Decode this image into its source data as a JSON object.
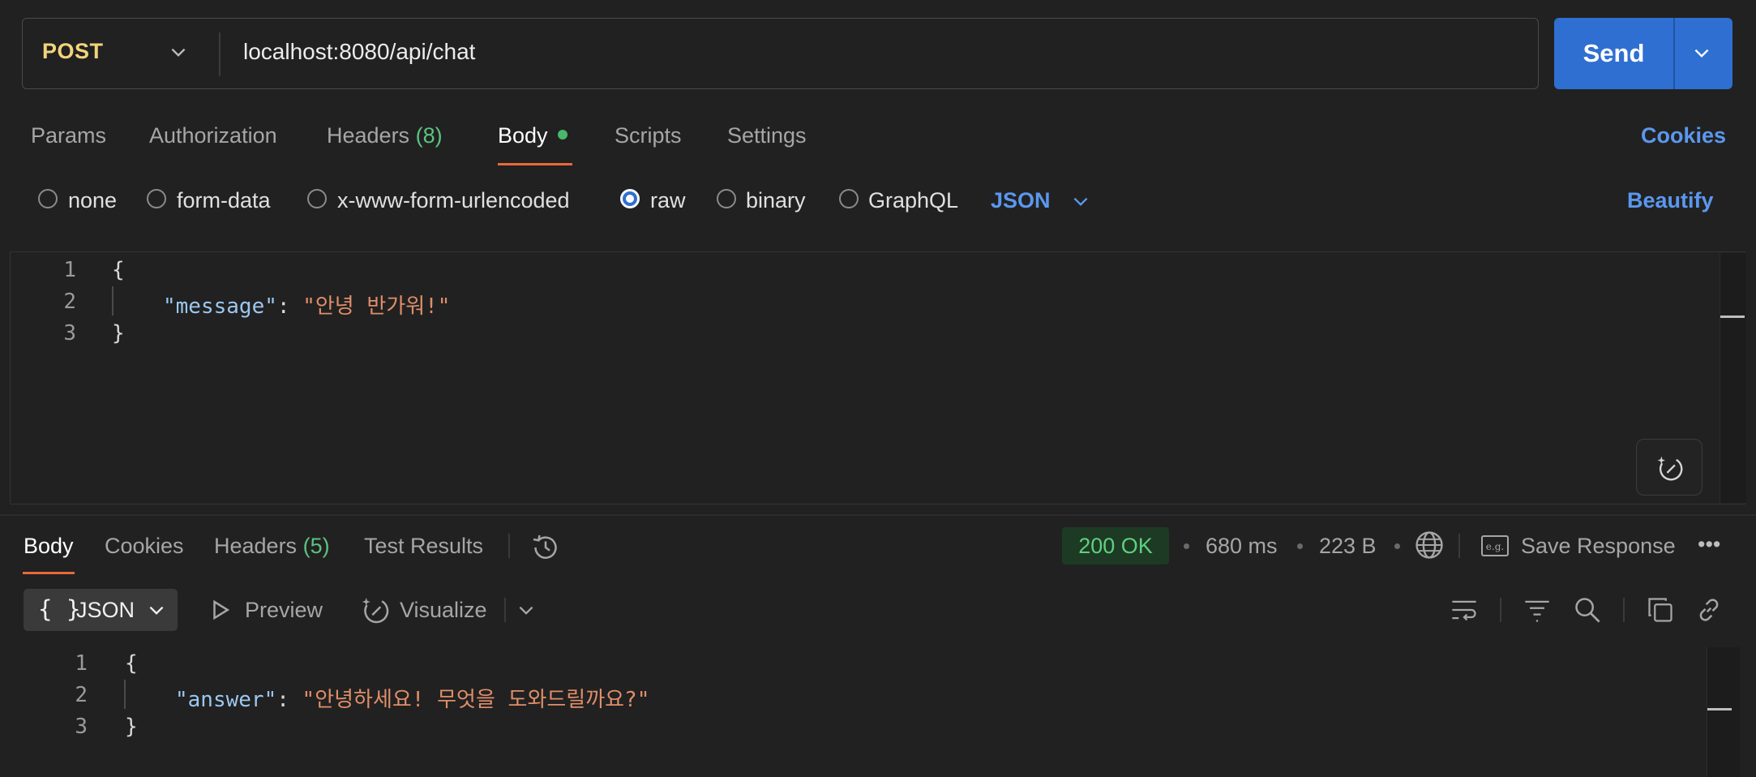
{
  "request": {
    "method": "POST",
    "url": "localhost:8080/api/chat",
    "send_label": "Send"
  },
  "request_tabs": [
    {
      "label": "Params"
    },
    {
      "label": "Authorization"
    },
    {
      "label": "Headers",
      "count": "(8)"
    },
    {
      "label": "Body"
    },
    {
      "label": "Scripts"
    },
    {
      "label": "Settings"
    }
  ],
  "cookies_link": "Cookies",
  "body_types": [
    "none",
    "form-data",
    "x-www-form-urlencoded",
    "raw",
    "binary",
    "GraphQL"
  ],
  "body_selected": "raw",
  "body_language": "JSON",
  "beautify_label": "Beautify",
  "request_body": {
    "line_numbers": [
      "1",
      "2",
      "3"
    ],
    "open_brace": "{",
    "key": "\"message\"",
    "colon": ": ",
    "value": "\"안녕 반가워!\"",
    "close_brace": "}"
  },
  "response_tabs": [
    {
      "label": "Body"
    },
    {
      "label": "Cookies"
    },
    {
      "label": "Headers",
      "count": "(5)"
    },
    {
      "label": "Test Results"
    }
  ],
  "response_meta": {
    "status": "200 OK",
    "time": "680 ms",
    "size": "223 B",
    "save_label": "Save Response",
    "more": "•••"
  },
  "response_toolbar": {
    "format_braces": "{ }",
    "format": "JSON",
    "preview": "Preview",
    "visualize": "Visualize"
  },
  "response_body": {
    "line_numbers": [
      "1",
      "2",
      "3"
    ],
    "open_brace": "{",
    "key": "\"answer\"",
    "colon": ": ",
    "value": "\"안녕하세요! 무엇을 도와드릴까요?\"",
    "close_brace": "}"
  },
  "colors": {
    "accent": "#2f6fd1",
    "method": "#f2d479",
    "tab_underline": "#e8693a",
    "status_ok": "#5fd07d"
  }
}
